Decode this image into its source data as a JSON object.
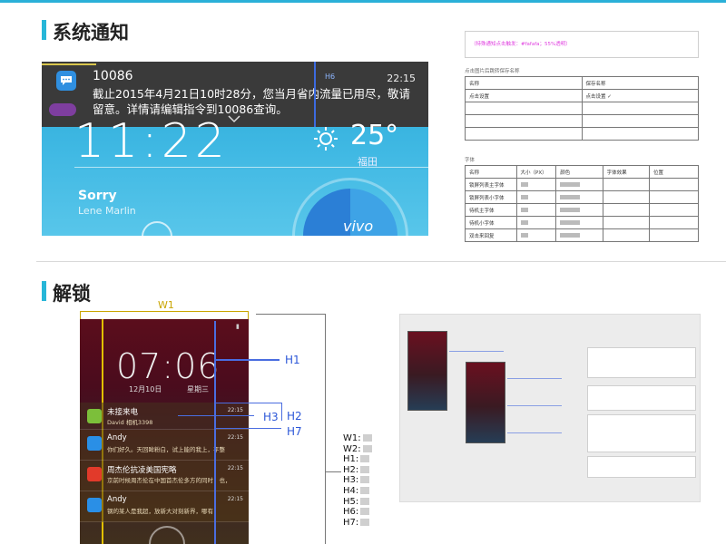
{
  "sections": {
    "notification_title": "系统通知",
    "unlock_title": "解锁"
  },
  "notification": {
    "sender": "10086",
    "time": "22:15",
    "body": "截止2015年4月21日10时28分，您当月省内流量已用尽，敬请留意。详情请编辑指令到10086查询。",
    "tag": "H6",
    "clock": "11:22",
    "temperature": "25°",
    "city": "福田",
    "song_title": "Sorry",
    "song_artist": "Lene Marlin",
    "brand": "vivo"
  },
  "spec_top": {
    "header_note": "（特殊通知点击触发：#fafafa；55%透明）",
    "table1_caption": "点击图片后跳转保存名称",
    "table1_headers": [
      "名称",
      "保存名称"
    ],
    "table1_rows": [
      [
        "点击设置",
        "点击设置 ✓"
      ],
      [
        "",
        ""
      ],
      [
        "",
        ""
      ],
      [
        "",
        ""
      ]
    ],
    "table2_caption": "字体",
    "table2_headers": [
      "名称",
      "大小（PX）",
      "颜色",
      "字体效果",
      "位置"
    ],
    "table2_rows": [
      [
        "锁屏列表主字体",
        "",
        "",
        "",
        ""
      ],
      [
        "锁屏列表小字体",
        "",
        "",
        "",
        ""
      ],
      [
        "待机主字体",
        "",
        "",
        "",
        ""
      ],
      [
        "待机小字体",
        "",
        "",
        "",
        ""
      ],
      [
        "双击来回复",
        "",
        "",
        "",
        ""
      ]
    ]
  },
  "unlock": {
    "clock": "07:06",
    "date": "12月10日",
    "weekday": "星期三",
    "items": [
      {
        "title": "未接来电",
        "sub": "David 相机3398",
        "time": "22:15",
        "icon_color": "#7cbf3a"
      },
      {
        "title": "Andy",
        "sub": "你们好久。天回眸粉白，试上能的我上，平整",
        "time": "22:15",
        "icon_color": "#2a8fe6"
      },
      {
        "title": "周杰伦抗凌美国宪略",
        "sub": "京前时候周杰伦在中国首杰伦多方的同时，也，",
        "time": "22:15",
        "icon_color": "#e23a2a"
      },
      {
        "title": "Andy",
        "sub": "钢的某人是我超，放新大对刻新界，哪有",
        "time": "22:15",
        "icon_color": "#2a8fe6"
      }
    ],
    "dims": {
      "w1": "W1",
      "h1": "H1",
      "h2": "H2",
      "h3": "H3",
      "h7": "H7"
    }
  },
  "legend": [
    "W1:",
    "W2:",
    "H1:",
    "H2:",
    "H3:",
    "H4:",
    "H5:",
    "H6:",
    "H7:"
  ]
}
